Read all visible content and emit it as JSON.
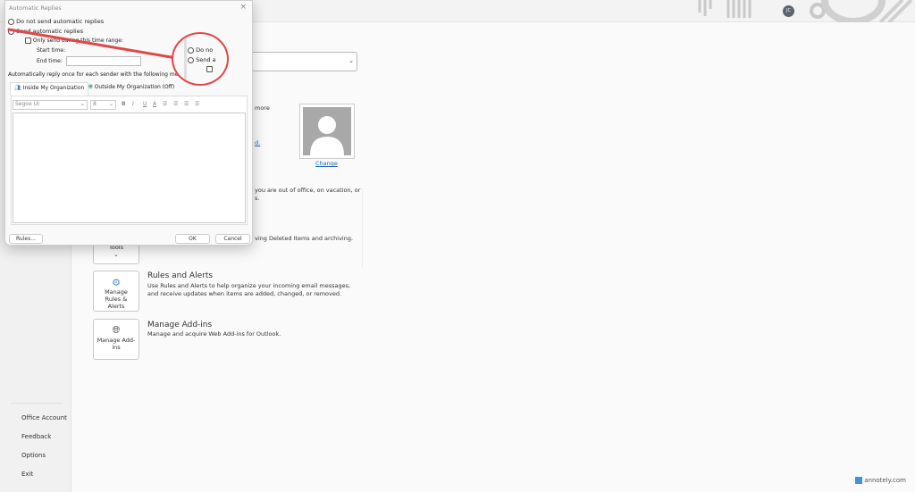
{
  "sidebar": {
    "items": [
      "Office Account",
      "Feedback",
      "Options",
      "Exit"
    ]
  },
  "main": {
    "partial_texts": [
      "more",
      "d.",
      "you are out of office, on vacation, or",
      "s.",
      "ving Deleted Items and archiving."
    ],
    "photo_change_link": "Change",
    "tools_card": "Tools",
    "rules": {
      "card": "Manage Rules & Alerts",
      "title": "Rules and Alerts",
      "desc": "Use Rules and Alerts to help organize your incoming email messages, and receive updates when items are added, changed, or removed."
    },
    "addins": {
      "card": "Manage Add-ins",
      "title": "Manage Add-ins",
      "desc": "Manage and acquire Web Add-ins for Outlook."
    }
  },
  "titlebar": {
    "avatar_initials": "JC"
  },
  "dialog": {
    "title": "Automatic Replies",
    "opt_no": "Do not send automatic replies",
    "opt_send": "Send automatic replies",
    "only_range": "Only send during this time range:",
    "start_label": "Start time:",
    "end_label": "End time:",
    "instruction": "Automatically reply once for each sender with the following messag",
    "tab_inside": "Inside My Organization",
    "tab_outside": "Outside My Organization (Off)",
    "font": "Segoe UI",
    "size": "8",
    "rules_btn": "Rules...",
    "ok_btn": "OK",
    "cancel_btn": "Cancel",
    "magnifier": {
      "opt_no": "Do no",
      "opt_send": "Send a"
    }
  },
  "watermark": "annotely.com",
  "colors": {
    "annotation": "#e04848",
    "link": "#1a66b8"
  }
}
